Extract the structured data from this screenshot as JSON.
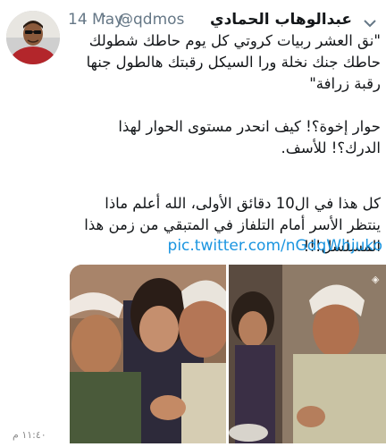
{
  "tweet": {
    "display_name": "عبدالوهاب الحمادي",
    "handle": "@qdmos",
    "separator": "·",
    "date": "14 May",
    "paragraph1": "\"نق العشر ربيات كروتي كل يوم حاطك شطولك حاطك جنك نخلة ورا السيكل رقبتك هالطول جنها رقبة زرافة\"",
    "paragraph2": "حوار إخوة؟! كيف انحدر مستوى الحوار لهذا الدرك؟! للأسف.",
    "paragraph3": "كل هذا في ال10 دقائق الأولى، الله أعلم ماذا ينتظر الأسر أمام التلفاز في المتبقي من زمن هذا المسلسل!!!",
    "link": "pic.twitter.com/nGdqWhjuko"
  },
  "statusbar": {
    "time": "١١:٤٠ م"
  },
  "colors": {
    "link": "#1b95e0",
    "muted": "#657786",
    "text": "#14171a"
  }
}
